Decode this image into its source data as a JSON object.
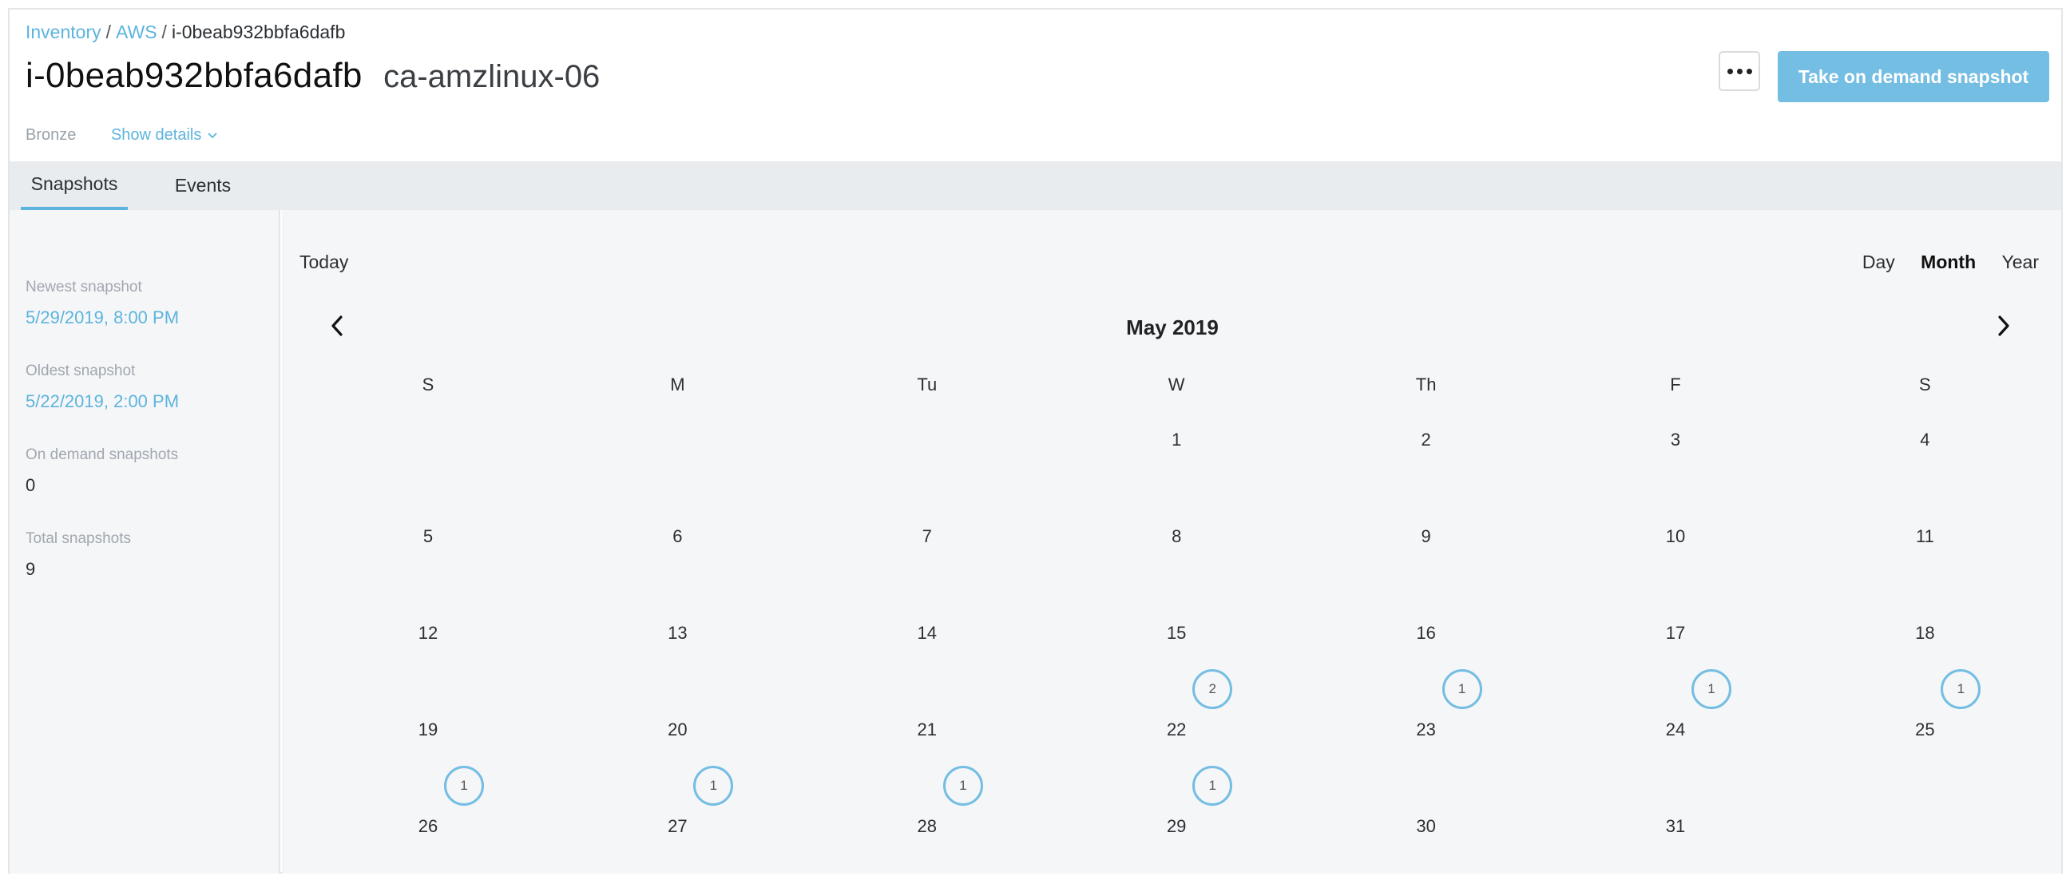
{
  "breadcrumb": {
    "inventory": "Inventory",
    "aws": "AWS",
    "current": "i-0beab932bbfa6dafb",
    "separator": "/"
  },
  "header": {
    "instance_id": "i-0beab932bbfa6dafb",
    "instance_name": "ca-amzlinux-06",
    "tier": "Bronze",
    "show_details": "Show details",
    "snapshot_button": "Take on demand snapshot",
    "more_icon": "more-dots-icon"
  },
  "tabs": [
    {
      "label": "Snapshots",
      "active": true
    },
    {
      "label": "Events",
      "active": false
    }
  ],
  "stats": {
    "newest_label": "Newest snapshot",
    "newest_value": "5/29/2019, 8:00 PM",
    "oldest_label": "Oldest snapshot",
    "oldest_value": "5/22/2019, 2:00 PM",
    "ondemand_label": "On demand snapshots",
    "ondemand_value": "0",
    "total_label": "Total snapshots",
    "total_value": "9"
  },
  "calendar": {
    "today_label": "Today",
    "views": [
      "Day",
      "Month",
      "Year"
    ],
    "selected_view": "Month",
    "month_label": "May 2019",
    "weekdays": [
      "S",
      "M",
      "Tu",
      "W",
      "Th",
      "F",
      "S"
    ],
    "weeks": [
      [
        "",
        "",
        "",
        "1",
        "2",
        "3",
        "4"
      ],
      [
        "5",
        "6",
        "7",
        "8",
        "9",
        "10",
        "11"
      ],
      [
        "12",
        "13",
        "14",
        "15",
        "16",
        "17",
        "18"
      ],
      [
        "19",
        "20",
        "21",
        "22",
        "23",
        "24",
        "25"
      ],
      [
        "26",
        "27",
        "28",
        "29",
        "30",
        "31",
        ""
      ]
    ],
    "snapshot_counts": {
      "22": "2",
      "23": "1",
      "24": "1",
      "25": "1",
      "26": "1",
      "27": "1",
      "28": "1",
      "29": "1"
    },
    "accent_color": "#74bde3"
  }
}
